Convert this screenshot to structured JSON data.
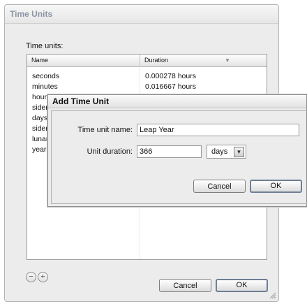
{
  "main_window": {
    "title": "Time Units",
    "units_label": "Time units:",
    "columns": {
      "name": "Name",
      "duration": "Duration"
    },
    "rows": [
      {
        "name": "seconds",
        "duration": "0.000278 hours"
      },
      {
        "name": "minutes",
        "duration": "0.016667 hours"
      },
      {
        "name": "hours",
        "duration": ""
      },
      {
        "name": "sider",
        "duration": ""
      },
      {
        "name": "days",
        "duration": ""
      },
      {
        "name": "sider",
        "duration": ""
      },
      {
        "name": "lunar",
        "duration": ""
      },
      {
        "name": "years",
        "duration": ""
      }
    ],
    "remove_symbol": "−",
    "add_symbol": "+",
    "cancel_label": "Cancel",
    "ok_label": "OK"
  },
  "add_dialog": {
    "title": "Add Time Unit",
    "name_label": "Time unit name:",
    "name_value": "Leap Year",
    "duration_label": "Unit duration:",
    "duration_value": "366",
    "unit_selected": "days",
    "cancel_label": "Cancel",
    "ok_label": "OK"
  }
}
